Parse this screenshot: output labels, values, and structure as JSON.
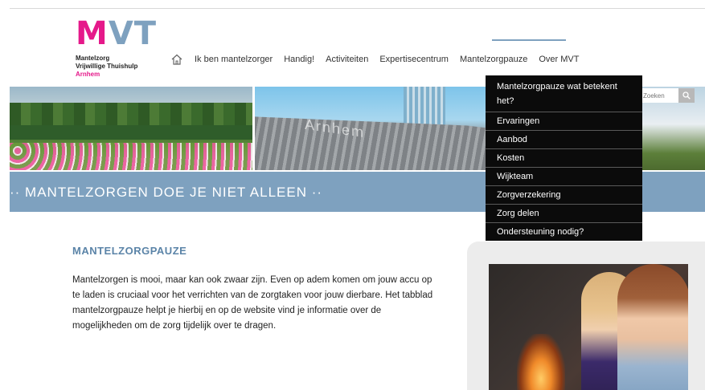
{
  "logo": {
    "mark_m": "M",
    "mark_vt": "VT",
    "line1": "Mantelzorg",
    "line2": "Vrijwillige Thuishulp",
    "city": "Arnhem"
  },
  "nav": {
    "items": [
      {
        "label": "Ik ben mantelzorger"
      },
      {
        "label": "Handig!"
      },
      {
        "label": "Activiteiten"
      },
      {
        "label": "Expertisecentrum"
      },
      {
        "label": "Mantelzorgpauze"
      },
      {
        "label": "Over MVT"
      }
    ],
    "active": "Mantelzorgpauze"
  },
  "search": {
    "placeholder": "Zoeken"
  },
  "dropdown": {
    "items": [
      {
        "label": "Mantelzorgpauze wat betekent het?"
      },
      {
        "label": "Ervaringen"
      },
      {
        "label": "Aanbod"
      },
      {
        "label": "Kosten"
      },
      {
        "label": "Wijkteam"
      },
      {
        "label": "Zorgverzekering"
      },
      {
        "label": "Zorg delen"
      },
      {
        "label": "Ondersteuning nodig?"
      }
    ]
  },
  "hero": {
    "sign_text": "Arnhem"
  },
  "banner": {
    "text": "·· MANTELZORGEN DOE JE NIET ALLEEN ··"
  },
  "content": {
    "title": "MANTELZORGPAUZE",
    "body": "Mantelzorgen is mooi, maar kan ook zwaar zijn. Even op adem komen om jouw accu op te laden is cruciaal voor het verrichten van de zorgtaken voor jouw dierbare.  Het tabblad mantelzorgpauze helpt je hierbij en op de website vind je informatie over de mogelijkheden om de zorg tijdelijk over te dragen."
  },
  "colors": {
    "brand_pink": "#e5198a",
    "brand_blue": "#7ea1bf",
    "dropdown_bg": "#0b0b0b"
  },
  "icons": {
    "home": "home-icon",
    "search": "search-icon"
  }
}
